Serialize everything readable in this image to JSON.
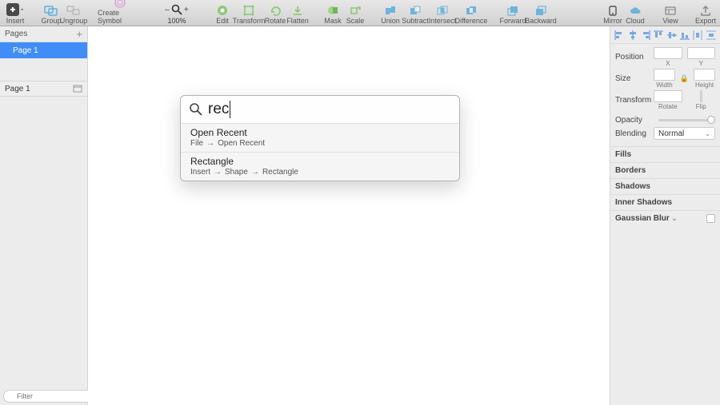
{
  "toolbar": {
    "insert": "Insert",
    "group": "Group",
    "ungroup": "Ungroup",
    "create_symbol": "Create Symbol",
    "zoom_out": "–",
    "zoom_value": "100%",
    "zoom_in": "+",
    "edit": "Edit",
    "transform": "Transform",
    "rotate": "Rotate",
    "flatten": "Flatten",
    "mask": "Mask",
    "scale": "Scale",
    "union": "Union",
    "subtract": "Subtract",
    "intersect": "Intersect",
    "difference": "Difference",
    "forward": "Forward",
    "backward": "Backward",
    "mirror": "Mirror",
    "cloud": "Cloud",
    "view": "View",
    "export": "Export"
  },
  "left": {
    "pages_header": "Pages",
    "page1": "Page 1",
    "current_page": "Page 1",
    "filter_placeholder": "Filter",
    "layers_count": "0"
  },
  "runner": {
    "query": "rec",
    "results": [
      {
        "title": "Open Recent",
        "path": [
          "File",
          "Open Recent"
        ]
      },
      {
        "title": "Rectangle",
        "path": [
          "Insert",
          "Shape",
          "Rectangle"
        ]
      }
    ]
  },
  "right": {
    "align": [
      "left",
      "h-center",
      "right",
      "top",
      "v-center",
      "bottom",
      "dist-h",
      "dist-v"
    ],
    "position_label": "Position",
    "x": "X",
    "y": "Y",
    "size_label": "Size",
    "width": "Width",
    "height": "Height",
    "transform_label": "Transform",
    "rotate": "Rotate",
    "flip": "Flip",
    "opacity_label": "Opacity",
    "blending_label": "Blending",
    "blending_value": "Normal",
    "sections": [
      "Fills",
      "Borders",
      "Shadows",
      "Inner Shadows",
      "Gaussian Blur"
    ]
  }
}
